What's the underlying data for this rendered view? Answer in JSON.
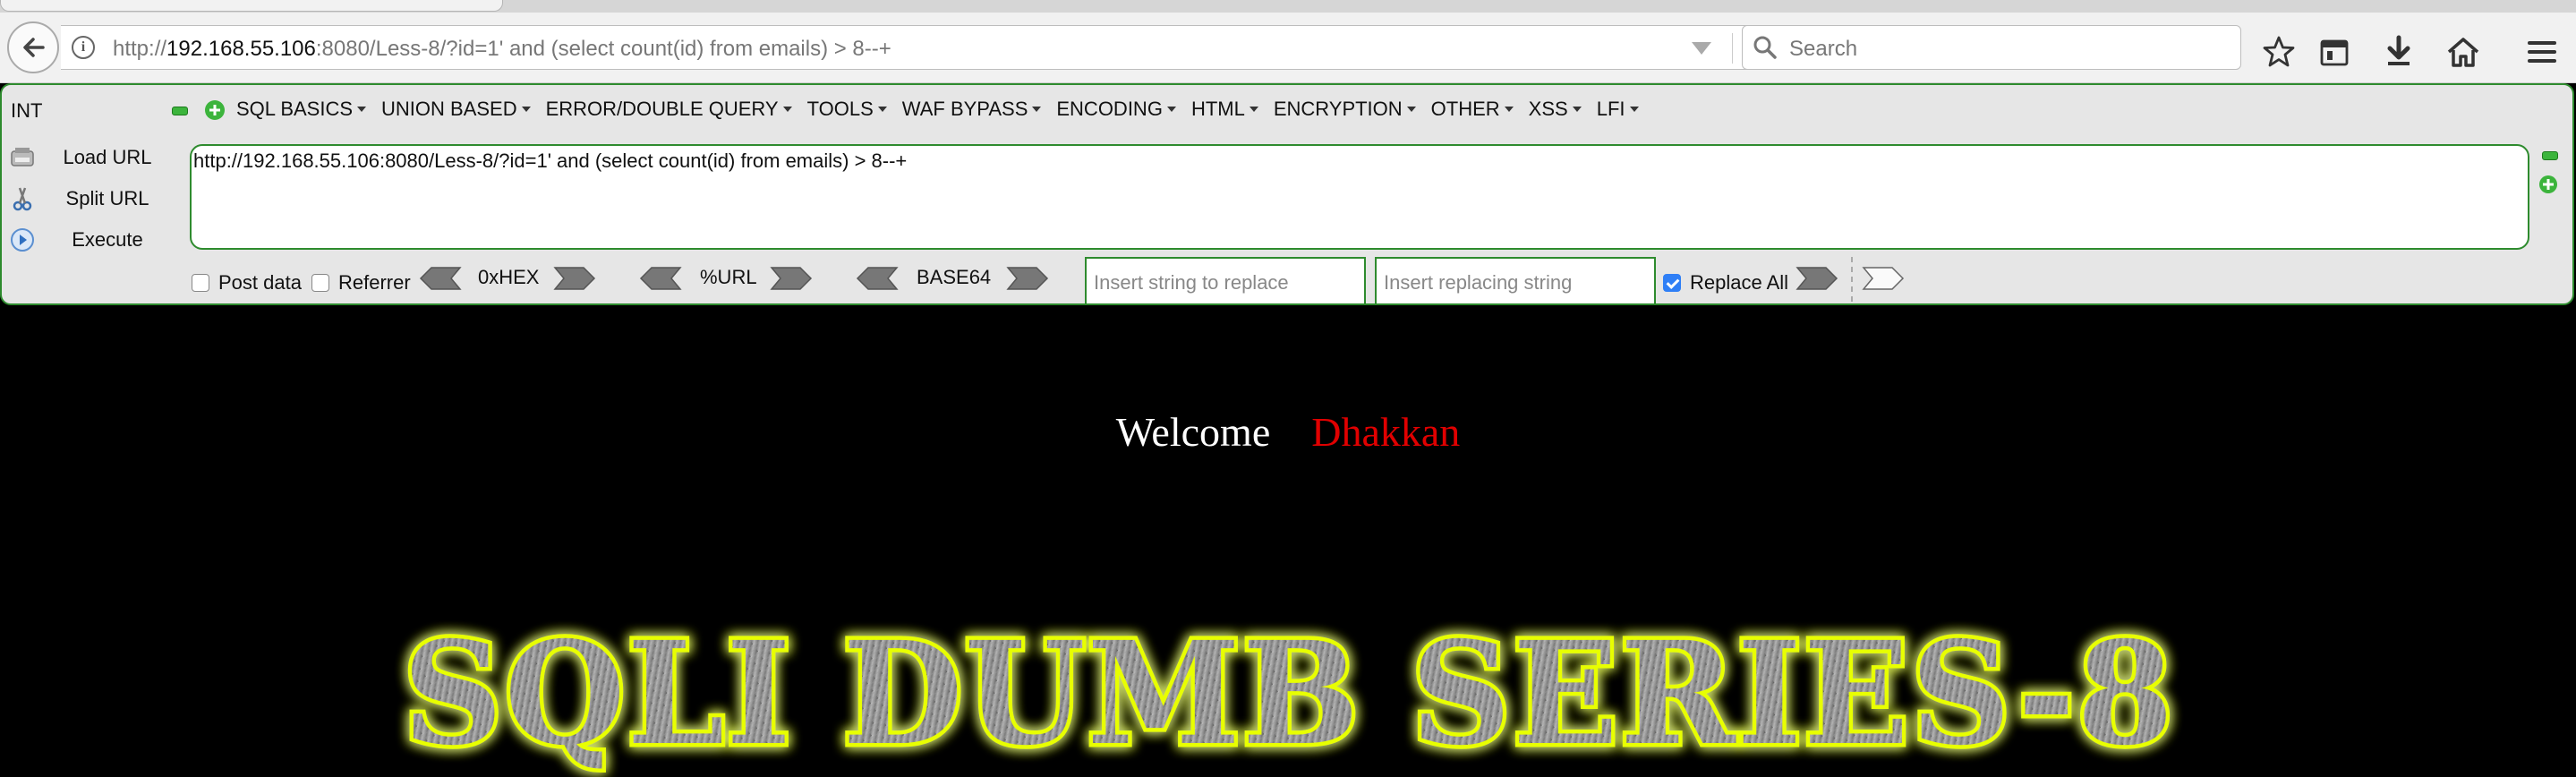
{
  "browser": {
    "url_prefix": "http://",
    "url_host": "192.168.55.106",
    "url_rest": ":8080/Less-8/?id=1' and (select count(id) from emails) > 8--+",
    "search_placeholder": "Search"
  },
  "hackbar": {
    "mode_label": "INT",
    "menus": [
      "SQL BASICS",
      "UNION BASED",
      "ERROR/DOUBLE QUERY",
      "TOOLS",
      "WAF BYPASS",
      "ENCODING",
      "HTML",
      "ENCRYPTION",
      "OTHER",
      "XSS",
      "LFI"
    ],
    "load_url_label": "Load URL",
    "split_url_label": "Split URL",
    "execute_label": "Execute",
    "url_value": "http://192.168.55.106:8080/Less-8/?id=1' and (select count(id) from emails) > 8--+",
    "post_data_label": "Post data",
    "post_data_checked": false,
    "referrer_label": "Referrer",
    "referrer_checked": false,
    "hex_label": "0xHEX",
    "url_enc_label": "%URL",
    "base64_label": "BASE64",
    "replace_from_placeholder": "Insert string to replace",
    "replace_to_placeholder": "Insert replacing string",
    "replace_all_label": "Replace All",
    "replace_all_checked": true
  },
  "page": {
    "welcome_text": "Welcome",
    "name_text": "Dhakkan",
    "banner_text": "SQLI DUMB SERIES-8"
  },
  "colors": {
    "hackbar_border": "#2e8b2e",
    "name_color": "#e00000",
    "banner_glow": "#e8ff00",
    "checkbox_checked": "#2f7ff6"
  }
}
